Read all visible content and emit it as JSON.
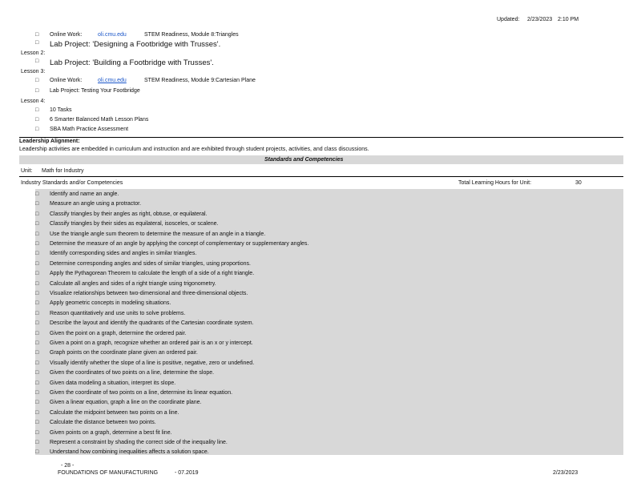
{
  "header": {
    "updated_label": "Updated:",
    "updated_date": "2/23/2023",
    "updated_time": "2:10 PM"
  },
  "bullet_glyph": "□",
  "lessons": [
    {
      "type": "bullet-line",
      "label": "Online Work:",
      "link": "oli.cmu.edu",
      "rest": "STEM Readiness, Module 8:Triangles"
    },
    {
      "type": "bullet-title",
      "text": "Lab Project: 'Designing a Footbridge with Trusses'."
    },
    {
      "type": "lesson",
      "text": "Lesson 2:"
    },
    {
      "type": "bullet-title",
      "text": "Lab Project: 'Building a Footbridge with Trusses'."
    },
    {
      "type": "lesson",
      "text": "Lesson 3:"
    },
    {
      "type": "bullet-line",
      "label": "Online Work:",
      "link": "oli.cmu.edu",
      "rest": "STEM Readiness, Module 9:Cartesian Plane"
    },
    {
      "type": "bullet-small",
      "text": "Lab Project: Testing Your Footbridge"
    },
    {
      "type": "lesson",
      "text": "Lesson 4:"
    },
    {
      "type": "bullet-small",
      "text": "10 Tasks"
    },
    {
      "type": "bullet-small",
      "text": "6 Smarter Balanced Math Lesson Plans"
    },
    {
      "type": "bullet-small",
      "text": "SBA Math Practice Assessment"
    }
  ],
  "leadership": {
    "heading": "Leadership Alignment:",
    "text": "Leadership activities are embedded in curriculum and instruction and are exhibited through student projects, activities, and class discussions."
  },
  "standards_heading": "Standards and Competencies",
  "unit": {
    "label": "Unit:",
    "name": "Math for Industry"
  },
  "table_header": {
    "left": "Industry Standards and/or Competencies",
    "hours_label": "Total Learning Hours for Unit:",
    "hours_value": "30"
  },
  "competencies": [
    "Identify and name an angle.",
    "Measure an angle using a protractor.",
    "Classify triangles by their angles as right, obtuse, or equilateral.",
    "Classify triangles by their sides as equilateral, isosceles, or scalene.",
    "Use the triangle angle sum theorem to determine the measure of an angle in a triangle.",
    "Determine the measure of an angle by applying the concept of complementary or supplementary angles.",
    "Identify corresponding sides and angles in similar triangles.",
    "Determine corresponding angles and sides of similar triangles, using proportions.",
    "Apply the Pythagorean Theorem to calculate the length of a side of a right triangle.",
    "Calculate all angles and sides of a right triangle using trigonometry.",
    "Visualize relationships between two-dimensional and three-dimensional objects.",
    "Apply geometric concepts in modeling situations.",
    "Reason quantitatively and use units to solve problems.",
    "Describe the layout and identify the quadrants of the Cartesian coordinate system.",
    "Given the point on a graph, determine the ordered pair.",
    "Given a point on a graph, recognize whether an ordered pair is an x or y intercept.",
    "Graph points on the coordinate plane given an ordered pair.",
    "Visually identify whether the slope of a line is positive, negative, zero or undefined.",
    "Given the coordinates of two points on a line, determine the slope.",
    "Given data modeling a situation, interpret its slope.",
    "Given the coordinate of two points on a line, determine its linear equation.",
    "Given a linear equation, graph a line on the coordinate plane.",
    "Calculate the midpoint between two points on a line.",
    "Calculate the distance between two points.",
    "Given points on a graph, determine a best fit line.",
    "Represent a constraint by shading the correct side of the inequality line.",
    "Understand how combining inequalities affects a solution space."
  ],
  "footer": {
    "page": "- 28 -",
    "left": "FOUNDATIONS OF MANUFACTURING",
    "version": "- 07.2019",
    "date": "2/23/2023"
  }
}
